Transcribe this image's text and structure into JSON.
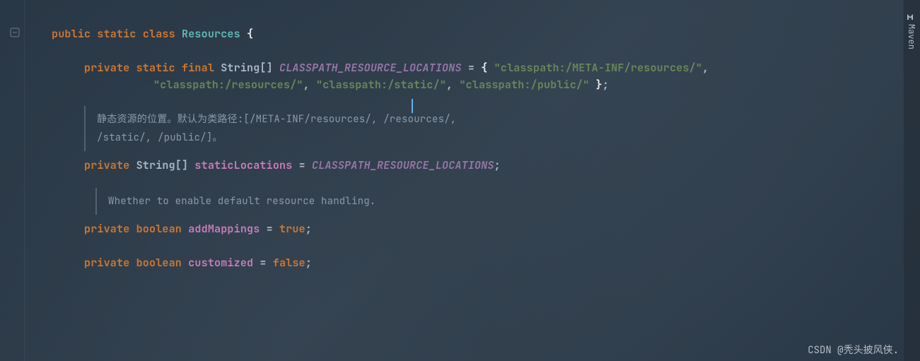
{
  "sidebar": {
    "maven_label": "Maven"
  },
  "code": {
    "l1": {
      "public": "public",
      "static": "static",
      "class": "class",
      "name": "Resources",
      "brace": "{"
    },
    "l3": {
      "private": "private",
      "static": "static",
      "final": "final",
      "type": "String[]",
      "name": "CLASSPATH_RESOURCE_LOCATIONS",
      "eq": " = ",
      "lb": "{ ",
      "s1": "\"classpath:/META-INF/resources/\"",
      "c1": ","
    },
    "l4": {
      "s2": "\"classpath:/resources/\"",
      "c2": ", ",
      "s3": "\"classpath:/static/\"",
      "c3": ", ",
      "s4": "\"classpath:/public/\"",
      "rb": " }",
      "semi": ";"
    },
    "doc1_a": "静态资源的位置。默认为类路径:[/META-INF/resources/,   /resources/,",
    "doc1_b": "/static/,   /public/]。",
    "l6": {
      "private": "private",
      "type": "String[]",
      "name": "staticLocations",
      "eq": " = ",
      "val": "CLASSPATH_RESOURCE_LOCATIONS",
      "semi": ";"
    },
    "doc2": "Whether to enable default resource handling.",
    "l8": {
      "private": "private",
      "type": "boolean",
      "name": "addMappings",
      "eq": " = ",
      "val": "true",
      "semi": ";"
    },
    "l10": {
      "private": "private",
      "type": "boolean",
      "name": "customized",
      "eq": " = ",
      "val": "false",
      "semi": ";"
    }
  },
  "watermark": "CSDN @秃头披风侠."
}
